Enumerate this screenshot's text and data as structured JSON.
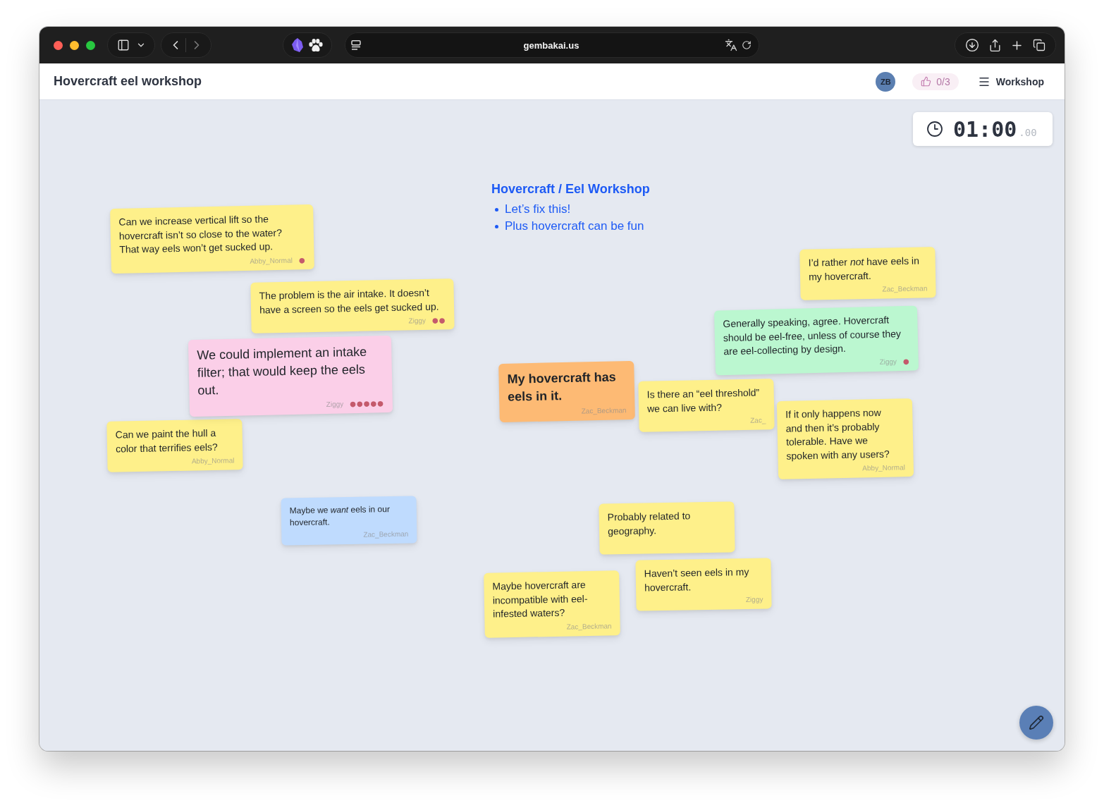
{
  "browser": {
    "url": "gembakai.us"
  },
  "header": {
    "title": "Hovercraft eel workshop",
    "avatar": "ZB",
    "votes": "0/3",
    "menu_label": "Workshop"
  },
  "timer": {
    "time": "01:00",
    "fraction": ".00"
  },
  "agenda": {
    "title": "Hovercraft / Eel Workshop",
    "items": [
      "Let’s fix this!",
      "Plus hovercraft can be fun"
    ]
  },
  "notes": [
    {
      "text": "Can we increase vertical lift so the hovercraft isn’t so close to the water? That way eels won’t get sucked up.",
      "author": "Abby_Normal",
      "color": "#fef08a",
      "votes": "●"
    },
    {
      "text": "The problem is the air intake. It doesn’t have a screen so the eels get sucked up.",
      "author": "Ziggy",
      "color": "#fef08a",
      "votes": "●●"
    },
    {
      "text": "We could implement an intake filter; that would keep the eels out.",
      "author": "Ziggy",
      "color": "#fbcfe8",
      "votes": "●●●●●"
    },
    {
      "text": "Can we paint the hull a color that terrifies eels?",
      "author": "Abby_Normal",
      "color": "#fef08a"
    },
    {
      "text": "Maybe we *want* eels in our hovercraft.",
      "author": "Zac_Beckman",
      "color": "#bfdbfe"
    },
    {
      "text": "My hovercraft has eels in it.",
      "author": "Zac_Beckman",
      "color": "#fdba74"
    },
    {
      "text": "I’d rather *not* have eels in my hovercraft.",
      "author": "Zac_Beckman",
      "color": "#fef08a"
    },
    {
      "text": "Generally speaking, agree. Hovercraft should be eel-free, unless of course they are eel-collecting by design.",
      "author": "Ziggy",
      "color": "#bbf7d0",
      "votes": "●"
    },
    {
      "text": "Is there an “eel threshold” we can live with?",
      "author": "Zac_",
      "color": "#fef08a"
    },
    {
      "text": "If it only happens now and then it’s probably tolerable. Have we spoken with any users?",
      "author": "Abby_Normal",
      "color": "#fef08a"
    },
    {
      "text": "Probably related to geography.",
      "color": "#fef08a"
    },
    {
      "text": "Haven’t seen eels in my hovercraft.",
      "author": "Ziggy",
      "color": "#fef08a"
    },
    {
      "text": "Maybe hovercraft are incompatible with eel-infested waters?",
      "author": "Zac_Beckman",
      "color": "#fef08a"
    }
  ]
}
